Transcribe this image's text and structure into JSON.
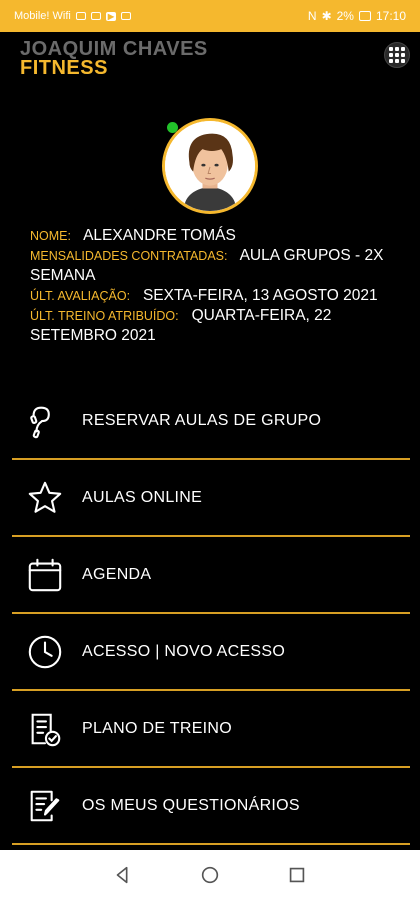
{
  "status_bar": {
    "carrier": "Mobile! Wifi",
    "battery": "2%",
    "time": "17:10"
  },
  "header": {
    "brand_line1": "JOAQUIM CHAVES",
    "brand_line2": "FITNESS",
    "menu_icon": "grid-menu-icon"
  },
  "profile": {
    "online": true,
    "name_label": "NOME:",
    "name": "ALEXANDRE TOMÁS",
    "plan_label": "MENSALIDADES CONTRATADAS:",
    "plan": "AULA GRUPOS - 2X SEMANA",
    "eval_label": "ÚLT. AVALIAÇÃO:",
    "eval": "SEXTA-FEIRA, 13 AGOSTO 2021",
    "training_label": "ÚLT. TREINO ATRIBUÍDO:",
    "training": "QUARTA-FEIRA, 22 SETEMBRO 2021"
  },
  "menu": {
    "items": [
      {
        "label": "RESERVAR AULAS DE GRUPO",
        "icon": "jump-rope-icon"
      },
      {
        "label": "AULAS ONLINE",
        "icon": "star-icon"
      },
      {
        "label": "AGENDA",
        "icon": "calendar-icon"
      },
      {
        "label": "ACESSO | NOVO ACESSO",
        "icon": "clock-icon"
      },
      {
        "label": "PLANO DE TREINO",
        "icon": "checklist-icon"
      },
      {
        "label": "OS MEUS QUESTIONÁRIOS",
        "icon": "form-edit-icon"
      }
    ]
  },
  "colors": {
    "accent": "#f5b82e",
    "background": "#000000",
    "online": "#22c12a"
  }
}
